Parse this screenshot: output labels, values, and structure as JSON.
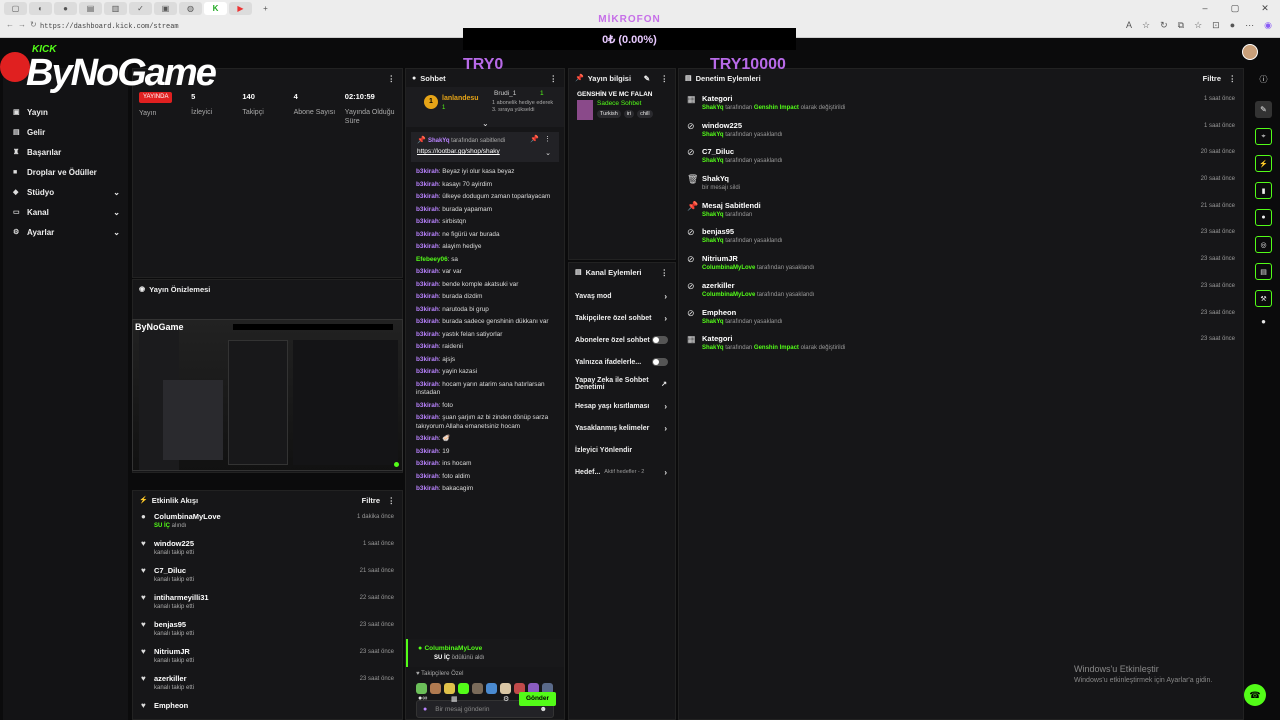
{
  "browser": {
    "url": "https://dashboard.kick.com/stream"
  },
  "overlay": {
    "mic_label": "MİKROFON",
    "mic_value": "0₺ (0.00%)",
    "goal_left": "TRY0",
    "goal_right": "TRY10000"
  },
  "logo": {
    "kick": "KICK",
    "text": "ByNoGame"
  },
  "sidebar": {
    "items": [
      {
        "label": "Yayın",
        "icon": "stream-icon"
      },
      {
        "label": "Gelir",
        "icon": "revenue-icon"
      },
      {
        "label": "Başarılar",
        "icon": "trophy-icon"
      },
      {
        "label": "Droplar ve Ödüller",
        "icon": "gift-icon"
      },
      {
        "label": "Stüdyo",
        "icon": "studio-icon"
      },
      {
        "label": "Kanal",
        "icon": "channel-icon"
      },
      {
        "label": "Ayarlar",
        "icon": "settings-icon"
      }
    ]
  },
  "stats": {
    "live_badge": "YAYINDA",
    "items": [
      {
        "value": "",
        "label": "Yayın"
      },
      {
        "value": "5",
        "label": "İzleyici"
      },
      {
        "value": "140",
        "label": "Takipçi"
      },
      {
        "value": "4",
        "label": "Abone Sayısı"
      },
      {
        "value": "02:10:59",
        "label": "Yayında Olduğu Süre"
      }
    ]
  },
  "preview": {
    "title": "Yayın Önizlemesi"
  },
  "activity": {
    "title": "Etkinlik Akışı",
    "filter": "Filtre",
    "rows": [
      {
        "name": "ColumbinaMyLove",
        "sub": "SU İÇ",
        "sub2": " alındı",
        "time": "1 dakika önce",
        "icon": "reward-icon"
      },
      {
        "name": "window225",
        "sub": "kanalı takip etti",
        "time": "1 saat önce",
        "icon": "heart-icon"
      },
      {
        "name": "C7_Diluc",
        "sub": "kanalı takip etti",
        "time": "21 saat önce",
        "icon": "heart-icon"
      },
      {
        "name": "intiharmeyilli31",
        "sub": "kanalı takip etti",
        "time": "22 saat önce",
        "icon": "heart-icon"
      },
      {
        "name": "benjas95",
        "sub": "kanalı takip etti",
        "time": "23 saat önce",
        "icon": "heart-icon"
      },
      {
        "name": "NitriumJR",
        "sub": "kanalı takip etti",
        "time": "23 saat önce",
        "icon": "heart-icon"
      },
      {
        "name": "azerkiller",
        "sub": "kanalı takip etti",
        "time": "23 saat önce",
        "icon": "heart-icon"
      },
      {
        "name": "Empheon",
        "sub": "",
        "time": "",
        "icon": "heart-icon"
      }
    ]
  },
  "chat": {
    "title": "Sohbet",
    "leader_name": "lanlandesu",
    "leader_count": "1",
    "gift_user": "Brudi_1",
    "gift_count": "1",
    "gift_text": "1 abonelik hediye ederek 3. sıraya yükseldi",
    "pinned_by": "ShakYq",
    "pinned_by_text": " tarafından sabitlendi",
    "pinned_link": "https://lootbar.gg/shop/shaky",
    "messages": [
      {
        "u": "b3kirah",
        "t": "Beyaz iyi olur kasa beyaz"
      },
      {
        "u": "b3kirah",
        "t": "kasayı 70 ayirdim"
      },
      {
        "u": "b3kirah",
        "t": "ülkeye dodugum zaman toparlayacam"
      },
      {
        "u": "b3kirah",
        "t": "burada yapamam"
      },
      {
        "u": "b3kirah",
        "t": "sirbistqn"
      },
      {
        "u": "b3kirah",
        "t": "ne figürü var burada"
      },
      {
        "u": "b3kirah",
        "t": "alayim hediye"
      },
      {
        "u": "Efebeey06",
        "t": "sa",
        "g": true
      },
      {
        "u": "b3kirah",
        "t": "var var"
      },
      {
        "u": "b3kirah",
        "t": "bende komple akatsuki var"
      },
      {
        "u": "b3kirah",
        "t": "burada dizdim"
      },
      {
        "u": "b3kirah",
        "t": "narutoda bi grup"
      },
      {
        "u": "b3kirah",
        "t": "burada sadece genshinin dükkanı var"
      },
      {
        "u": "b3kirah",
        "t": "yastık felan satiyorlar"
      },
      {
        "u": "b3kirah",
        "t": "raidenii"
      },
      {
        "u": "b3kirah",
        "t": "ajsjs"
      },
      {
        "u": "b3kirah",
        "t": "yayin kazasi"
      },
      {
        "u": "b3kirah",
        "t": "hocam yarın atarim sana hatırlarsan instadan"
      },
      {
        "u": "b3kirah",
        "t": "foto"
      },
      {
        "u": "b3kirah",
        "t": "şuan şarjım az bi zinden dönüp sarza takıyorum Allaha emanetsiniz hocam"
      },
      {
        "u": "b3kirah",
        "t": "🦪"
      },
      {
        "u": "b3kirah",
        "t": "19"
      },
      {
        "u": "b3kirah",
        "t": "ins hocam"
      },
      {
        "u": "b3kirah",
        "t": "foto aldim"
      },
      {
        "u": "b3kirah",
        "t": "bakacagim"
      }
    ],
    "reward_user": "ColumbinaMyLove",
    "reward_name": "SU İÇ",
    "reward_text": " ödülünü aldı",
    "followers_only": "Takipçilere Özel",
    "input_placeholder": "Bir mesaj gönderin",
    "send": "Gönder"
  },
  "stream_info": {
    "title": "Yayın bilgisi",
    "stream_title": "GENSHİN VE MC FALAN",
    "category": "Sadece Sohbet",
    "tags": [
      "Turkish",
      "iri",
      "chill"
    ]
  },
  "channel_actions": {
    "title": "Kanal Eylemleri",
    "rows": [
      {
        "label": "Yavaş mod",
        "type": "chev"
      },
      {
        "label": "Takipçilere özel sohbet",
        "type": "chev"
      },
      {
        "label": "Abonelere özel sohbet",
        "type": "toggle"
      },
      {
        "label": "Yalnızca ifadelerle...",
        "type": "toggle"
      },
      {
        "label": "Yapay Zeka ile Sohbet Denetimi",
        "type": "ext"
      },
      {
        "label": "Hesap yaşı kısıtlaması",
        "type": "chev"
      },
      {
        "label": "Yasaklanmış kelimeler",
        "type": "chev"
      },
      {
        "label": "İzleyici Yönlendir",
        "type": "none"
      },
      {
        "label": "Hedef...",
        "type": "chev",
        "extra": "Aktif hedefler - 2"
      }
    ]
  },
  "mod": {
    "title": "Denetim Eylemleri",
    "filter": "Filtre",
    "rows": [
      {
        "name": "Kategori",
        "icon": "category-icon",
        "sub_user": "ShakYq",
        "sub_a": " tarafından ",
        "sub_hl": "Genshin Impact",
        "sub_b": " olarak değiştirildi",
        "time": "1 saat önce"
      },
      {
        "name": "window225",
        "icon": "ban-icon",
        "sub_user": "ShakYq",
        "sub_a": " tarafından yasaklandı",
        "sub_hl": "",
        "sub_b": "",
        "time": "1 saat önce"
      },
      {
        "name": "C7_Diluc",
        "icon": "ban-icon",
        "sub_user": "ShakYq",
        "sub_a": " tarafından yasaklandı",
        "sub_hl": "",
        "sub_b": "",
        "time": "20 saat önce"
      },
      {
        "name": "ShakYq",
        "icon": "trash-icon",
        "sub_user": "",
        "sub_a": "bir mesajı sildi",
        "sub_hl": "",
        "sub_b": "",
        "time": "20 saat önce"
      },
      {
        "name": "Mesaj Sabitlendi",
        "icon": "pin-icon",
        "sub_user": "ShakYq",
        "sub_a": " tarafından",
        "sub_hl": "",
        "sub_b": "",
        "time": "21 saat önce"
      },
      {
        "name": "benjas95",
        "icon": "ban-icon",
        "sub_user": "ShakYq",
        "sub_a": " tarafından yasaklandı",
        "sub_hl": "",
        "sub_b": "",
        "time": "23 saat önce"
      },
      {
        "name": "NitriumJR",
        "icon": "ban-icon",
        "sub_user": "ColumbinaMyLove",
        "sub_a": " tarafından yasaklandı",
        "sub_hl": "",
        "sub_b": "",
        "time": "23 saat önce"
      },
      {
        "name": "azerkiller",
        "icon": "ban-icon",
        "sub_user": "ColumbinaMyLove",
        "sub_a": " tarafından yasaklandı",
        "sub_hl": "",
        "sub_b": "",
        "time": "23 saat önce"
      },
      {
        "name": "Empheon",
        "icon": "ban-icon",
        "sub_user": "ShakYq",
        "sub_a": " tarafından yasaklandı",
        "sub_hl": "",
        "sub_b": "",
        "time": "23 saat önce"
      },
      {
        "name": "Kategori",
        "icon": "category-icon",
        "sub_user": "ShakYq",
        "sub_a": " tarafından ",
        "sub_hl": "Genshin Impact",
        "sub_b": " olarak değiştirildi",
        "time": "23 saat önce"
      }
    ]
  },
  "windows": {
    "activate_title": "Windows'u Etkinleştir",
    "activate_sub": "Windows'u etkinleştirmek için Ayarlar'a gidin."
  },
  "colors": {
    "accent": "#53fc18",
    "username": "#b983ff",
    "live": "#e02020",
    "bg": "#0b0b0c",
    "panel": "#161618"
  }
}
